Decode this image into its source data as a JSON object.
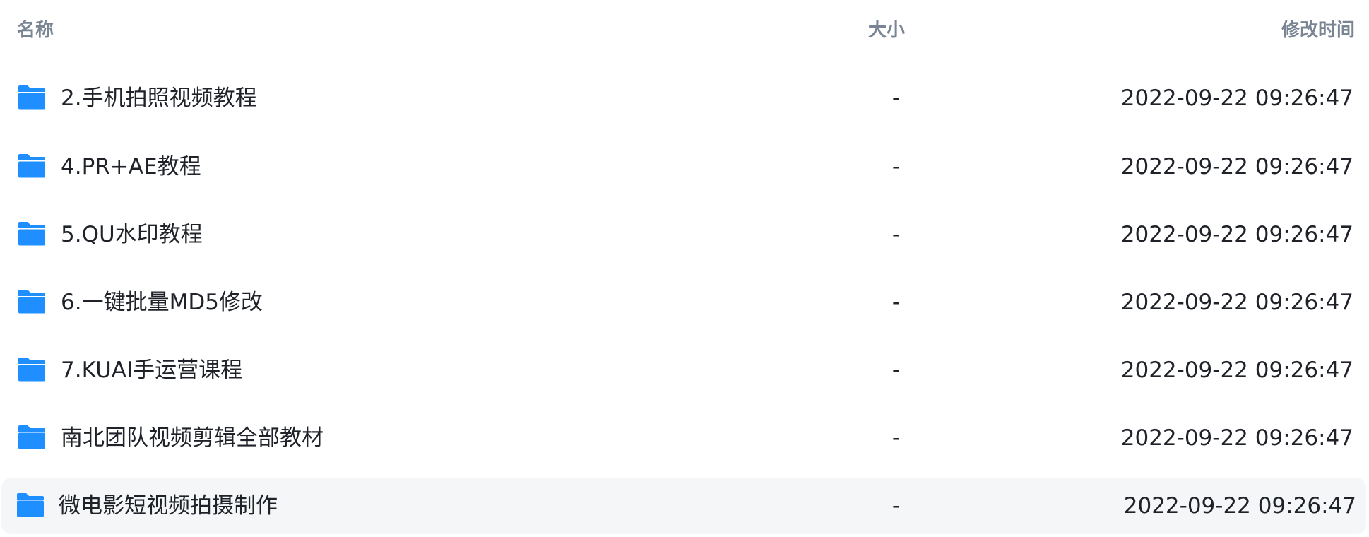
{
  "header": {
    "name_label": "名称",
    "size_label": "大小",
    "time_label": "修改时间"
  },
  "colors": {
    "folder_icon": "#1f8fff",
    "folder_icon_dark": "#1578e0",
    "header_text": "#7a8594",
    "selected_row_bg": "#f5f6f7"
  },
  "files": [
    {
      "icon": "folder-icon",
      "name": "2.手机拍照视频教程",
      "size": "-",
      "modified": "2022-09-22 09:26:47"
    },
    {
      "icon": "folder-icon",
      "name": "4.PR+AE教程",
      "size": "-",
      "modified": "2022-09-22 09:26:47"
    },
    {
      "icon": "folder-icon",
      "name": "5.QU水印教程",
      "size": "-",
      "modified": "2022-09-22 09:26:47"
    },
    {
      "icon": "folder-icon",
      "name": "6.一键批量MD5修改",
      "size": "-",
      "modified": "2022-09-22 09:26:47"
    },
    {
      "icon": "folder-icon",
      "name": "7.KUAI手运营课程",
      "size": "-",
      "modified": "2022-09-22 09:26:47"
    },
    {
      "icon": "folder-icon",
      "name": "南北团队视频剪辑全部教材",
      "size": "-",
      "modified": "2022-09-22 09:26:47"
    },
    {
      "icon": "folder-icon",
      "name": "微电影短视频拍摄制作",
      "size": "-",
      "modified": "2022-09-22 09:26:47",
      "selected": true
    }
  ]
}
